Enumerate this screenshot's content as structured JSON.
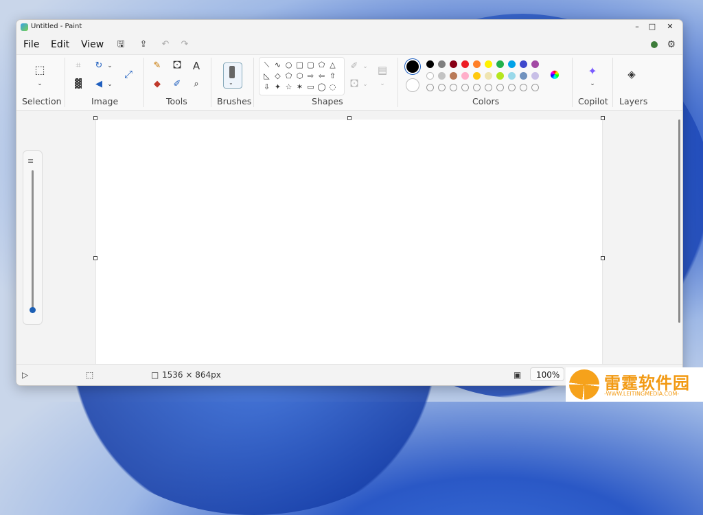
{
  "window": {
    "title": "Untitled - Paint"
  },
  "window_controls": {
    "minimize": "–",
    "maximize": "□",
    "close": "✕"
  },
  "menu": {
    "file": "File",
    "edit": "Edit",
    "view": "View"
  },
  "quick": {
    "save_icon": "save-icon",
    "share_icon": "share-icon",
    "undo_icon": "undo-icon",
    "redo_icon": "redo-icon"
  },
  "ribbon": {
    "groups": {
      "selection": "Selection",
      "image": "Image",
      "tools": "Tools",
      "brushes": "Brushes",
      "shapes": "Shapes",
      "colors": "Colors",
      "copilot": "Copilot",
      "layers": "Layers"
    },
    "colors": {
      "primary": "#000000",
      "secondary": "#ffffff",
      "row1": [
        "#000000",
        "#7f7f7f",
        "#880015",
        "#ed1c24",
        "#ff7f27",
        "#fff200",
        "#22b14c",
        "#00a2e8",
        "#3f48cc",
        "#a349a4"
      ],
      "row2": [
        "#ffffff",
        "#c3c3c3",
        "#b97a57",
        "#ffaec9",
        "#ffc90e",
        "#efe4b0",
        "#b5e61d",
        "#99d9ea",
        "#7092be",
        "#c8bfe7"
      ]
    }
  },
  "status": {
    "canvas_size": "1536 × 864px",
    "zoom": "100%"
  },
  "watermark": {
    "name": "雷霆软件园",
    "url": "WWW.LEITINGMEDIA.COM"
  }
}
